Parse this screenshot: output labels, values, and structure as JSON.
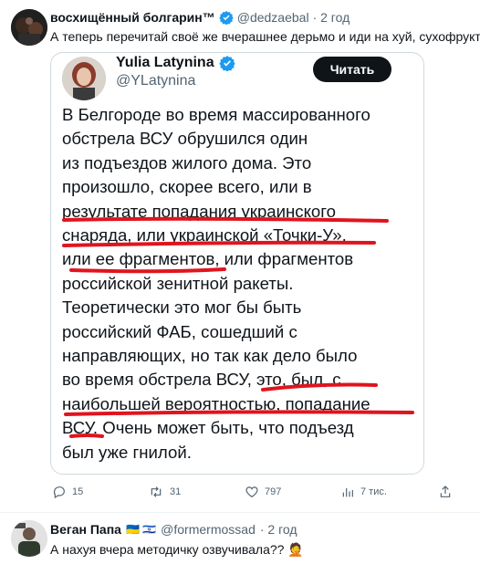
{
  "post": {
    "author": "восхищённый болгарин™",
    "handle": "@dedzaebal",
    "time": "· 2 год",
    "text": "А теперь перечитай своё же вчерашнее дерьмо и иди на хуй, сухофрукт",
    "quote": {
      "author": "Yulia Latynina",
      "handle": "@YLatynina",
      "read_button": "Читать",
      "lines": [
        "В Белгороде во время массированного",
        "обстрела ВСУ обрушился один",
        "из подъездов жилого дома. Это",
        "произошло, скорее всего, или в",
        "результате попадания украинского",
        "снаряда, или украинской «Точки-У»,",
        "или ее фрагментов, или фрагментов",
        "российской зенитной ракеты.",
        "Теоретически это мог бы быть",
        "российский ФАБ, сошедший с",
        "направляющих, но так как дело было",
        "во время обстрела ВСУ, это, был, с",
        "наибольшей вероятностью, попадание",
        "ВСУ. Очень может быть, что подъезд",
        "был уже гнилой."
      ]
    },
    "actions": {
      "replies": "15",
      "reposts": "31",
      "likes": "797",
      "views": "7 тис."
    }
  },
  "reply": {
    "author": "Веган Папа",
    "flags": "🇺🇦 🇮🇱",
    "handle": "@formermossad",
    "time": "· 2 год",
    "text": "А нахуя вчера методичку озвучивала?? 🤦"
  },
  "colors": {
    "text": "#0f1419",
    "secondary": "#536471",
    "border": "#cfd9de",
    "verified": "#1d9bf0",
    "underline": "#e0141e"
  }
}
